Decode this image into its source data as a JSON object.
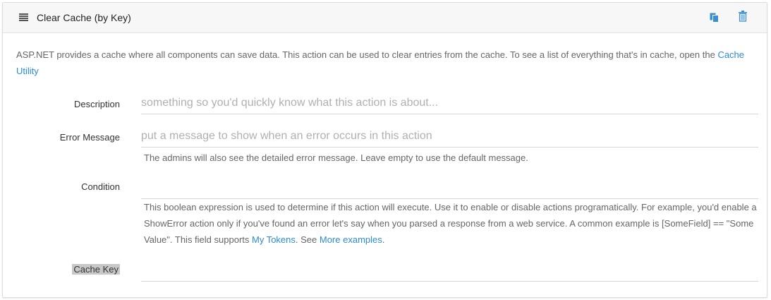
{
  "panel": {
    "title": "Clear Cache (by Key)"
  },
  "intro": {
    "text": "ASP.NET provides a cache where all components can save data. This action can be used to clear entries from the cache. To see a list of everything that's in cache, open the ",
    "link": "Cache Utility"
  },
  "fields": {
    "description": {
      "label": "Description",
      "value": "",
      "placeholder": "something so you'd quickly know what this action is about..."
    },
    "error_message": {
      "label": "Error Message",
      "value": "",
      "placeholder": "put a message to show when an error occurs in this action",
      "help": "The admins will also see the detailed error message. Leave empty to use the default message."
    },
    "condition": {
      "label": "Condition",
      "value": "",
      "placeholder": "",
      "help_text": "This boolean expression is used to determine if this action will execute. Use it to enable or disable actions programatically. For example, you'd enable a ShowError action only if you've found an error let's say when you parsed a response from a web service. A common example is [SomeField] == \"Some Value\". This field supports ",
      "help_link1": "My Tokens",
      "help_mid": ". See ",
      "help_link2": "More examples",
      "help_end": "."
    },
    "cache_key": {
      "label": "Cache Key",
      "value": "",
      "placeholder": ""
    }
  },
  "colors": {
    "link": "#2b8bd6",
    "icon_blue": "#3a8ed4"
  },
  "icons": {
    "drag": "drag-handle-icon",
    "copy": "copy-icon",
    "trash": "trash-icon"
  }
}
